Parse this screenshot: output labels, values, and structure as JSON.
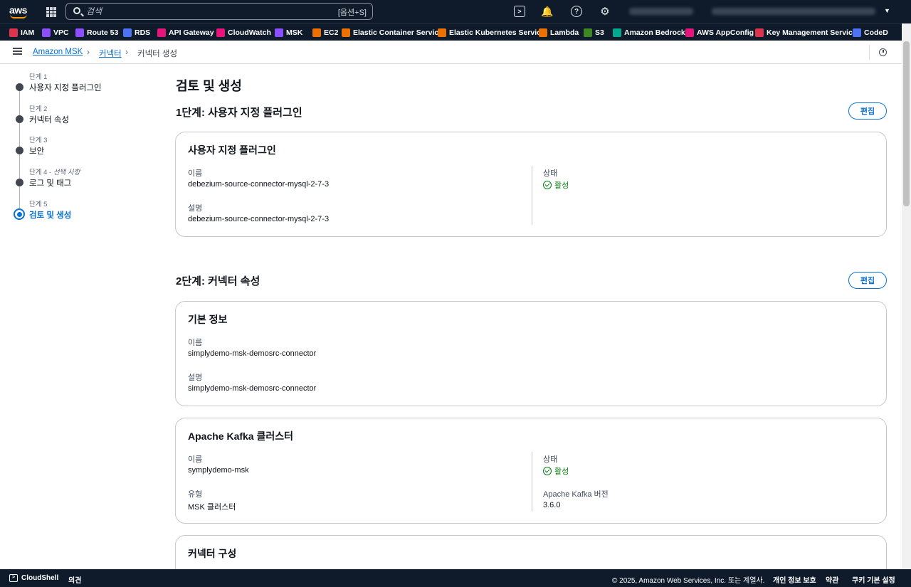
{
  "topnav": {
    "logo_text": "aws",
    "search_placeholder": "검색",
    "search_shortcut": "[옵션+S]"
  },
  "favorites": [
    {
      "label": "IAM",
      "color": "#dd344c"
    },
    {
      "label": "VPC",
      "color": "#8c4fff"
    },
    {
      "label": "Route 53",
      "color": "#8c4fff"
    },
    {
      "label": "RDS",
      "color": "#4d72f3"
    },
    {
      "label": "API Gateway",
      "color": "#e7157b"
    },
    {
      "label": "CloudWatch",
      "color": "#e7157b"
    },
    {
      "label": "MSK",
      "color": "#8c4fff"
    },
    {
      "label": "EC2",
      "color": "#ed7100"
    },
    {
      "label": "Elastic Container Service",
      "color": "#ed7100"
    },
    {
      "label": "Elastic Kubernetes Service",
      "color": "#ed7100"
    },
    {
      "label": "Lambda",
      "color": "#ed7100"
    },
    {
      "label": "S3",
      "color": "#3f8624"
    },
    {
      "label": "Amazon Bedrock",
      "color": "#01a88d"
    },
    {
      "label": "AWS AppConfig",
      "color": "#e7157b"
    },
    {
      "label": "Key Management Service",
      "color": "#dd344c"
    },
    {
      "label": "CodeD",
      "color": "#4d72f3"
    }
  ],
  "breadcrumb": {
    "root": "Amazon MSK",
    "parent": "커넥터",
    "current": "커넥터 생성"
  },
  "wizard": {
    "steps": [
      {
        "sub": "단계 1",
        "label": "사용자 지정 플러그인"
      },
      {
        "sub": "단계 2",
        "label": "커넥터 속성"
      },
      {
        "sub": "단계 3",
        "label": "보안"
      },
      {
        "sub": "단계 4 - ",
        "optional": "선택 사항",
        "label": "로그 및 태그"
      },
      {
        "sub": "단계 5",
        "label": "검토 및 생성"
      }
    ]
  },
  "main": {
    "title": "검토 및 생성",
    "edit_label": "편집",
    "step1": {
      "title": "1단계: 사용자 지정 플러그인",
      "card_title": "사용자 지정 플러그인",
      "name_key": "이름",
      "name_val": "debezium-source-connector-mysql-2-7-3",
      "desc_key": "설명",
      "desc_val": "debezium-source-connector-mysql-2-7-3",
      "status_key": "상태",
      "status_val": "활성"
    },
    "step2": {
      "title": "2단계: 커넥터 속성",
      "basic": {
        "card_title": "기본 정보",
        "name_key": "이름",
        "name_val": "simplydemo-msk-demosrc-connector",
        "desc_key": "설명",
        "desc_val": "simplydemo-msk-demosrc-connector"
      },
      "kafka": {
        "card_title": "Apache Kafka 클러스터",
        "name_key": "이름",
        "name_val": "symplydemo-msk",
        "type_key": "유형",
        "type_val": "MSK 클러스터",
        "status_key": "상태",
        "status_val": "활성",
        "version_key": "Apache Kafka 버전",
        "version_val": "3.6.0"
      },
      "config": {
        "card_title": "커넥터 구성"
      }
    }
  },
  "footer": {
    "cloudshell": "CloudShell",
    "feedback": "의견",
    "copyright": "© 2025, Amazon Web Services, Inc. 또는 계열사.",
    "privacy": "개인 정보 보호",
    "terms": "약관",
    "cookies": "쿠키 기본 설정"
  }
}
